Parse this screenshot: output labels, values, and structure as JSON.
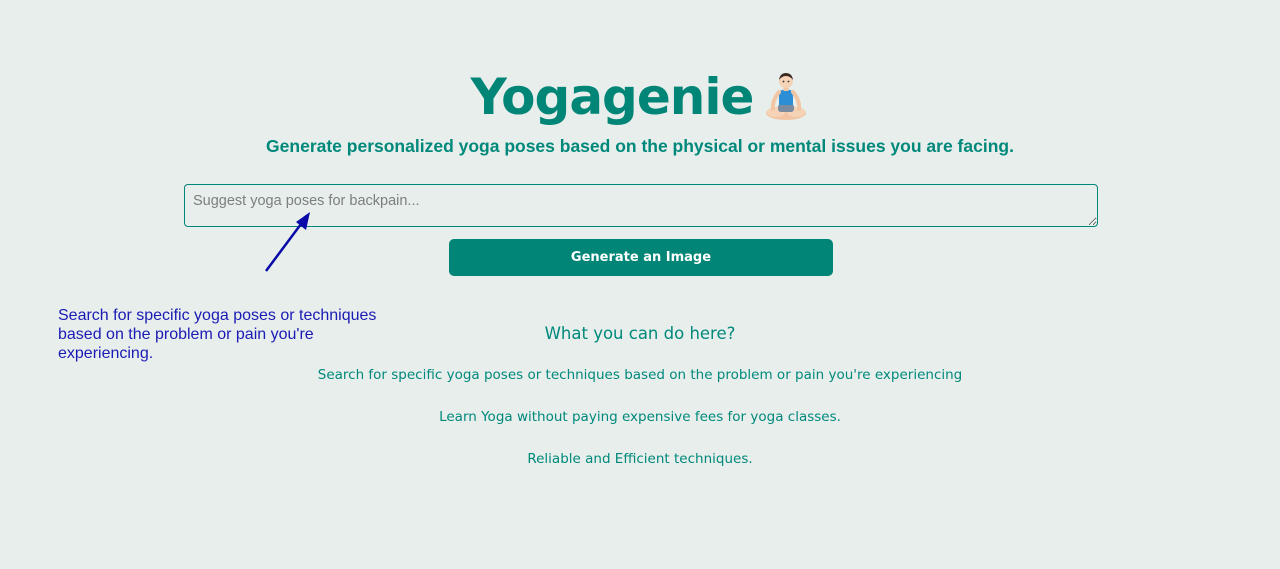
{
  "header": {
    "title": "Yogagenie",
    "emoji_icon": "person-in-lotus-position-icon",
    "subtitle": "Generate personalized yoga poses based on the physical or mental issues you are facing."
  },
  "prompt": {
    "placeholder": "Suggest yoga poses for backpain...",
    "value": ""
  },
  "generate_button": {
    "label": "Generate an Image"
  },
  "annotation": {
    "text": "Search for specific yoga poses or techniques based on the problem or pain you're experiencing.",
    "arrow_icon": "arrow-up-right-icon",
    "color": "#1a1ab4"
  },
  "features": {
    "heading": "What you can do here?",
    "items": [
      "Search for specific yoga poses or techniques based on the problem or pain you're experiencing",
      "Learn Yoga without paying expensive fees for yoga classes.",
      "Reliable and Efficient techniques."
    ]
  },
  "colors": {
    "accent": "#008577",
    "background": "#e7eeec"
  }
}
